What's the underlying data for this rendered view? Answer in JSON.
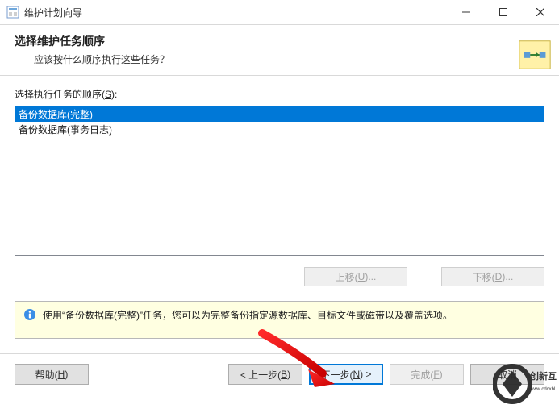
{
  "window": {
    "title": "维护计划向导"
  },
  "header": {
    "title": "选择维护任务顺序",
    "subtitle": "应该按什么顺序执行这些任务？"
  },
  "content": {
    "order_label_pre": "选择执行任务的顺序(",
    "order_label_key": "S",
    "order_label_post": "):",
    "items": [
      {
        "text": "备份数据库(完整)",
        "selected": true
      },
      {
        "text": "备份数据库(事务日志)",
        "selected": false
      }
    ],
    "move_up_pre": "上移(",
    "move_up_key": "U",
    "move_up_post": ")...",
    "move_down_pre": "下移(",
    "move_down_key": "D",
    "move_down_post": ")..."
  },
  "info": {
    "text": "使用“备份数据库(完整)”任务，您可以为完整备份指定源数据库、目标文件或磁带以及覆盖选项。"
  },
  "footer": {
    "help_pre": "帮助(",
    "help_key": "H",
    "help_post": ")",
    "back_pre": "< 上一步(",
    "back_key": "B",
    "back_post": ")",
    "next_pre": "下一步(",
    "next_key": "N",
    "next_post": ") >",
    "finish_pre": "完成(",
    "finish_key": "F",
    "finish_post": ")",
    "cancel": "取消"
  }
}
